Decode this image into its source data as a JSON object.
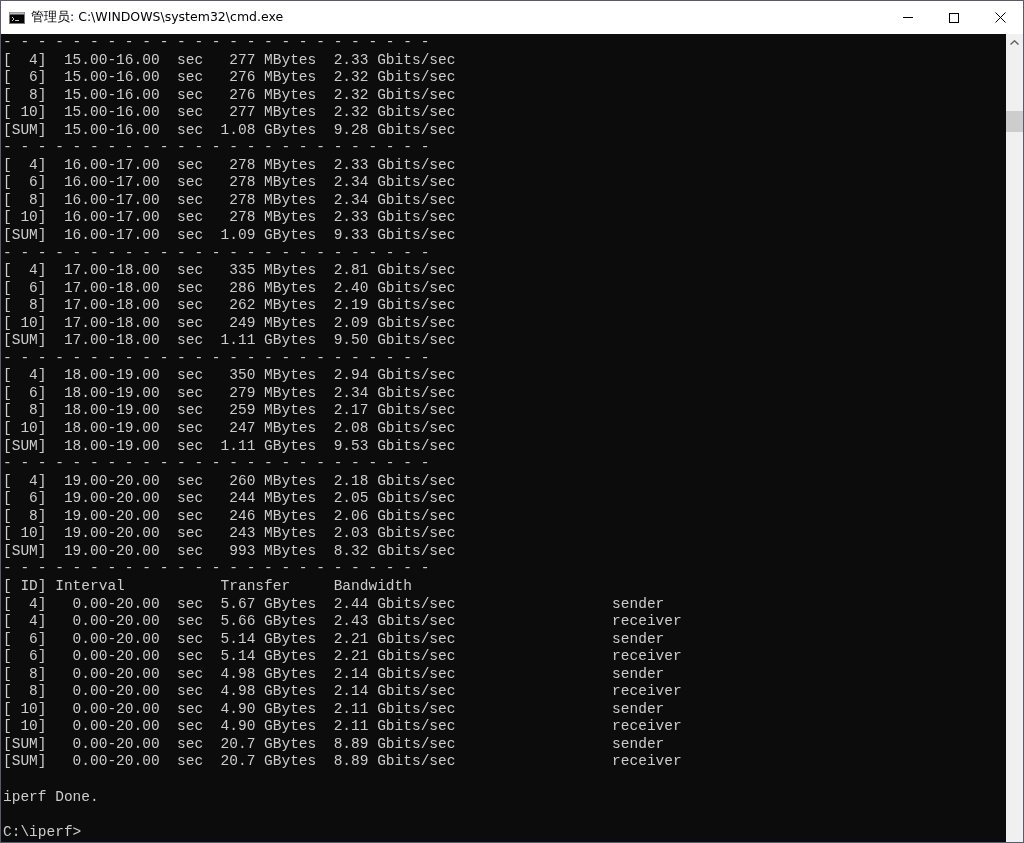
{
  "window": {
    "title": "管理员: C:\\WINDOWS\\system32\\cmd.exe"
  },
  "console": {
    "blocks": [
      {
        "lines": [
          "- - - - - - - - - - - - - - - - - - - - - - - - -",
          "[  4]  15.00-16.00  sec   277 MBytes  2.33 Gbits/sec",
          "[  6]  15.00-16.00  sec   276 MBytes  2.32 Gbits/sec",
          "[  8]  15.00-16.00  sec   276 MBytes  2.32 Gbits/sec",
          "[ 10]  15.00-16.00  sec   277 MBytes  2.32 Gbits/sec",
          "[SUM]  15.00-16.00  sec  1.08 GBytes  9.28 Gbits/sec",
          "- - - - - - - - - - - - - - - - - - - - - - - - -",
          "[  4]  16.00-17.00  sec   278 MBytes  2.33 Gbits/sec",
          "[  6]  16.00-17.00  sec   278 MBytes  2.34 Gbits/sec",
          "[  8]  16.00-17.00  sec   278 MBytes  2.34 Gbits/sec",
          "[ 10]  16.00-17.00  sec   278 MBytes  2.33 Gbits/sec",
          "[SUM]  16.00-17.00  sec  1.09 GBytes  9.33 Gbits/sec",
          "- - - - - - - - - - - - - - - - - - - - - - - - -",
          "[  4]  17.00-18.00  sec   335 MBytes  2.81 Gbits/sec",
          "[  6]  17.00-18.00  sec   286 MBytes  2.40 Gbits/sec",
          "[  8]  17.00-18.00  sec   262 MBytes  2.19 Gbits/sec",
          "[ 10]  17.00-18.00  sec   249 MBytes  2.09 Gbits/sec",
          "[SUM]  17.00-18.00  sec  1.11 GBytes  9.50 Gbits/sec",
          "- - - - - - - - - - - - - - - - - - - - - - - - -",
          "[  4]  18.00-19.00  sec   350 MBytes  2.94 Gbits/sec",
          "[  6]  18.00-19.00  sec   279 MBytes  2.34 Gbits/sec",
          "[  8]  18.00-19.00  sec   259 MBytes  2.17 Gbits/sec",
          "[ 10]  18.00-19.00  sec   247 MBytes  2.08 Gbits/sec",
          "[SUM]  18.00-19.00  sec  1.11 GBytes  9.53 Gbits/sec",
          "- - - - - - - - - - - - - - - - - - - - - - - - -",
          "[  4]  19.00-20.00  sec   260 MBytes  2.18 Gbits/sec",
          "[  6]  19.00-20.00  sec   244 MBytes  2.05 Gbits/sec",
          "[  8]  19.00-20.00  sec   246 MBytes  2.06 Gbits/sec",
          "[ 10]  19.00-20.00  sec   243 MBytes  2.03 Gbits/sec",
          "[SUM]  19.00-20.00  sec   993 MBytes  8.32 Gbits/sec",
          "- - - - - - - - - - - - - - - - - - - - - - - - -",
          "[ ID] Interval           Transfer     Bandwidth",
          "[  4]   0.00-20.00  sec  5.67 GBytes  2.44 Gbits/sec                  sender",
          "[  4]   0.00-20.00  sec  5.66 GBytes  2.43 Gbits/sec                  receiver",
          "[  6]   0.00-20.00  sec  5.14 GBytes  2.21 Gbits/sec                  sender",
          "[  6]   0.00-20.00  sec  5.14 GBytes  2.21 Gbits/sec                  receiver",
          "[  8]   0.00-20.00  sec  4.98 GBytes  2.14 Gbits/sec                  sender",
          "[  8]   0.00-20.00  sec  4.98 GBytes  2.14 Gbits/sec                  receiver",
          "[ 10]   0.00-20.00  sec  4.90 GBytes  2.11 Gbits/sec                  sender",
          "[ 10]   0.00-20.00  sec  4.90 GBytes  2.11 Gbits/sec                  receiver",
          "[SUM]   0.00-20.00  sec  20.7 GBytes  8.89 Gbits/sec                  sender",
          "[SUM]   0.00-20.00  sec  20.7 GBytes  8.89 Gbits/sec                  receiver"
        ]
      },
      {
        "lines": [
          "iperf Done."
        ]
      },
      {
        "lines": [
          "C:\\iperf>"
        ]
      }
    ]
  }
}
